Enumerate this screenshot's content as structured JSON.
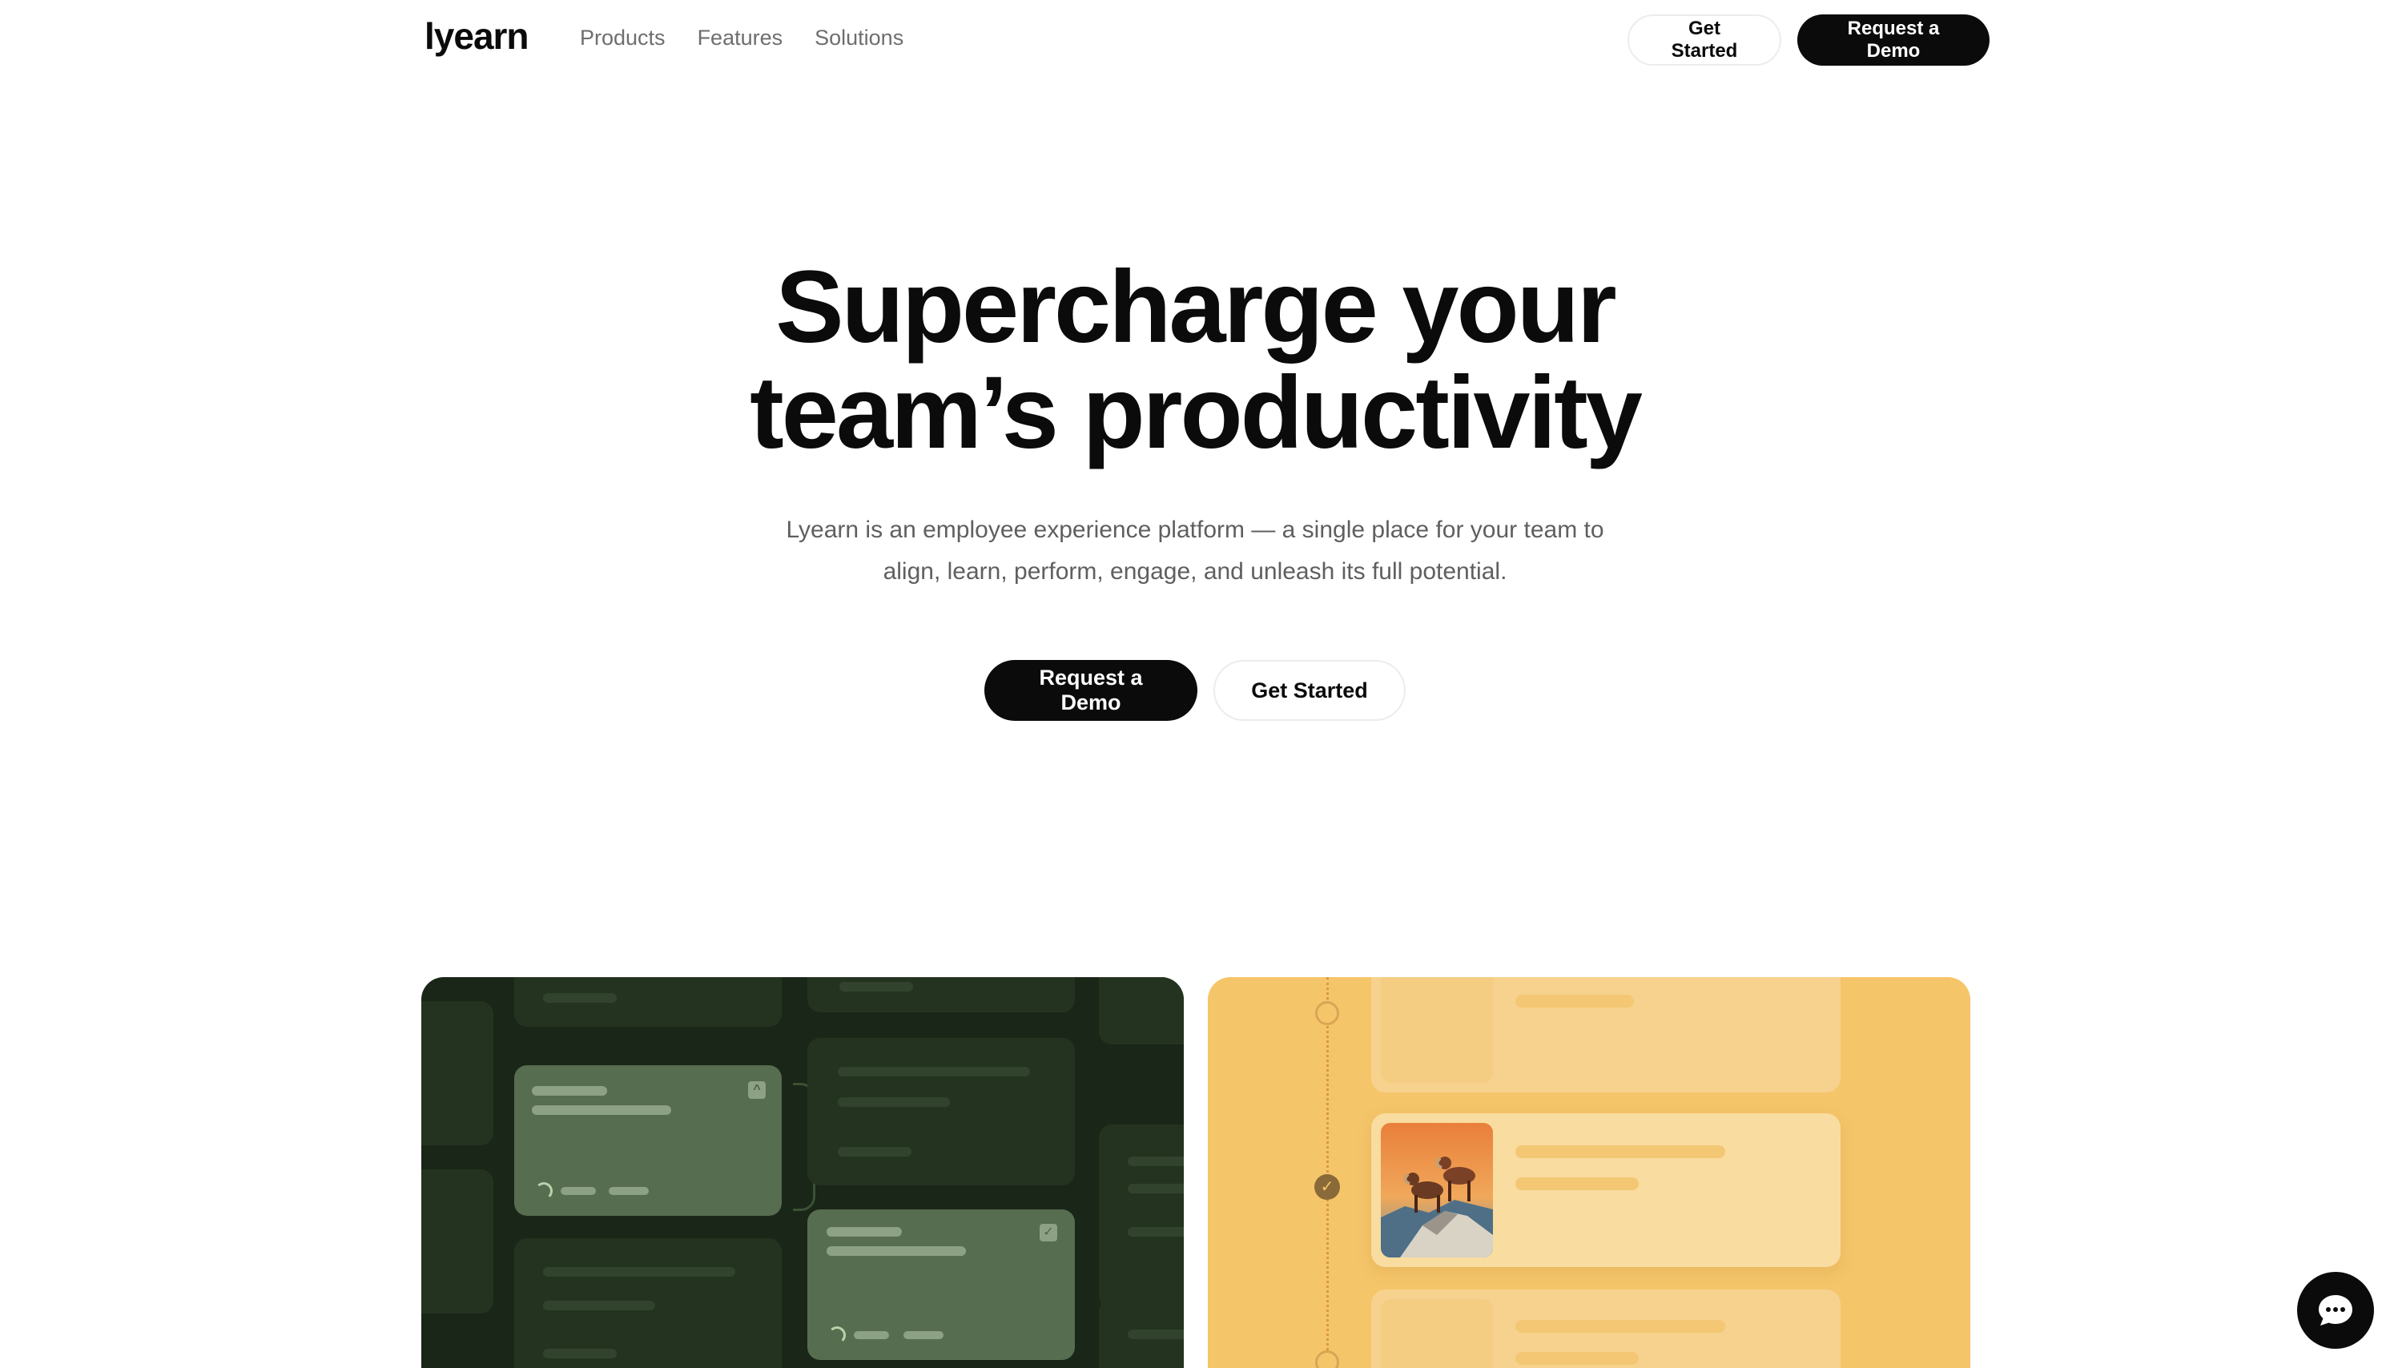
{
  "brand": {
    "logo": "lyearn"
  },
  "nav": {
    "links": [
      "Products",
      "Features",
      "Solutions"
    ],
    "get_started": "Get Started",
    "request_demo": "Request a Demo"
  },
  "hero": {
    "title_line1": "Supercharge your",
    "title_line2": "team’s productivity",
    "subtitle_line1": "Lyearn is an employee experience platform — a single place for your team to",
    "subtitle_line2": "align, learn, perform, engage, and unleash its full potential.",
    "cta_primary": "Request a Demo",
    "cta_secondary": "Get Started"
  },
  "colors": {
    "ink": "#0b0b0b",
    "muted": "#6e6e6e",
    "dark_card": "#1a2617",
    "yellow_card": "#f5c56a"
  },
  "icons": {
    "chat": "chat-bubble-icon",
    "check": "check-icon",
    "chevrons_up": "chevrons-up-icon"
  }
}
